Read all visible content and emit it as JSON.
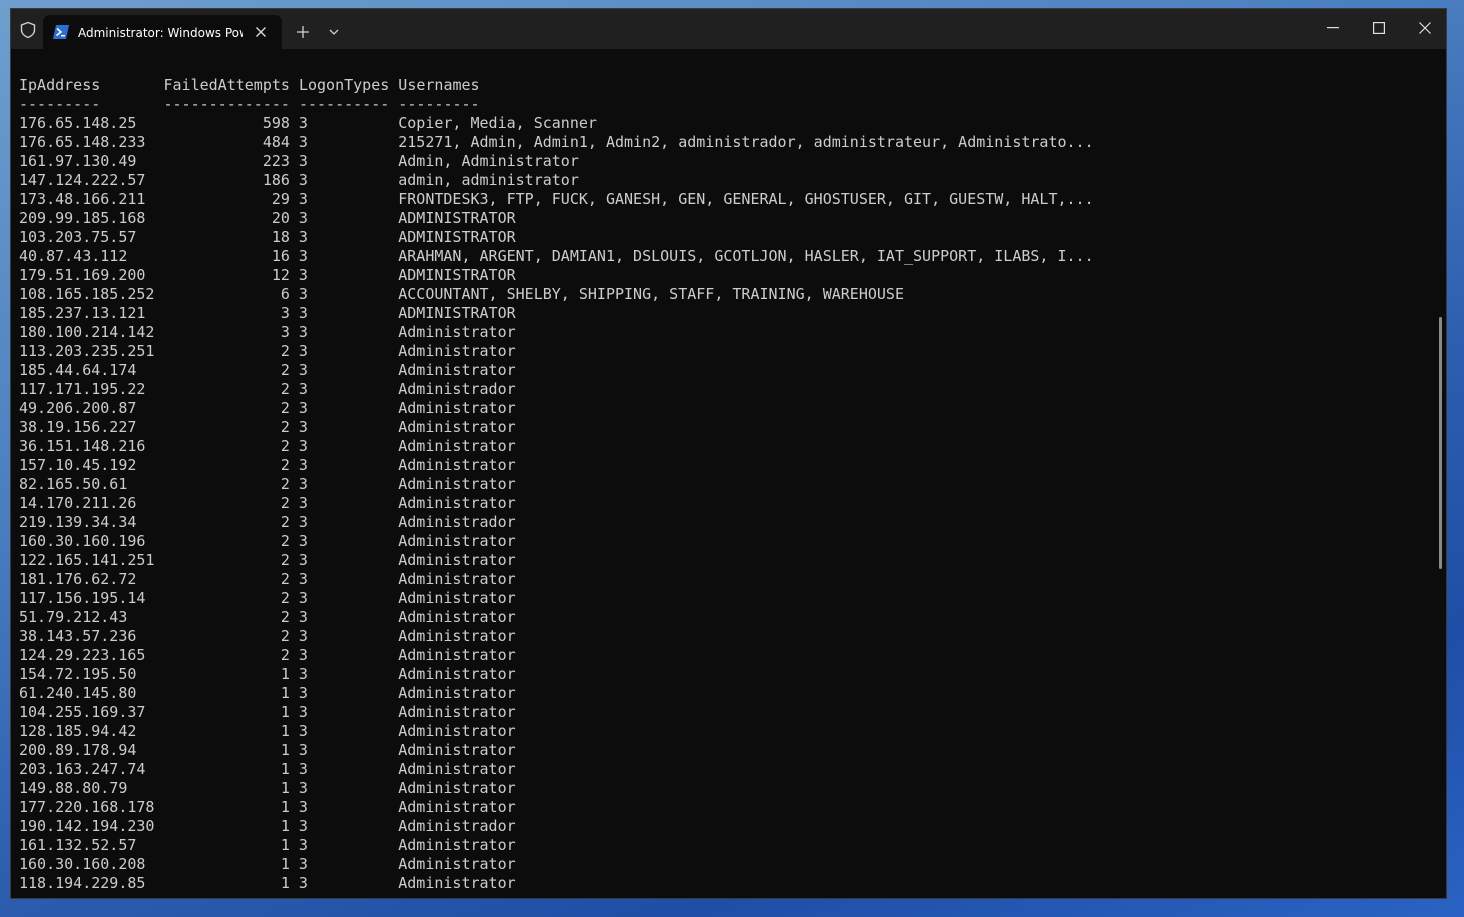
{
  "window": {
    "tab_title": "Administrator: Windows PowerShell"
  },
  "terminal": {
    "header": "IpAddress       FailedAttempts LogonTypes Usernames",
    "separator": "---------       -------------- ---------- ---------",
    "rows": [
      {
        "ip": "176.65.148.25",
        "attempts": "598",
        "logon": "3",
        "users": "Copier, Media, Scanner"
      },
      {
        "ip": "176.65.148.233",
        "attempts": "484",
        "logon": "3",
        "users": "215271, Admin, Admin1, Admin2, administrador, administrateur, Administrato..."
      },
      {
        "ip": "161.97.130.49",
        "attempts": "223",
        "logon": "3",
        "users": "Admin, Administrator"
      },
      {
        "ip": "147.124.222.57",
        "attempts": "186",
        "logon": "3",
        "users": "admin, administrator"
      },
      {
        "ip": "173.48.166.211",
        "attempts": "29",
        "logon": "3",
        "users": "FRONTDESK3, FTP, FUCK, GANESH, GEN, GENERAL, GHOSTUSER, GIT, GUESTW, HALT,..."
      },
      {
        "ip": "209.99.185.168",
        "attempts": "20",
        "logon": "3",
        "users": "ADMINISTRATOR"
      },
      {
        "ip": "103.203.75.57",
        "attempts": "18",
        "logon": "3",
        "users": "ADMINISTRATOR"
      },
      {
        "ip": "40.87.43.112",
        "attempts": "16",
        "logon": "3",
        "users": "ARAHMAN, ARGENT, DAMIAN1, DSLOUIS, GCOTLJON, HASLER, IAT_SUPPORT, ILABS, I..."
      },
      {
        "ip": "179.51.169.200",
        "attempts": "12",
        "logon": "3",
        "users": "ADMINISTRATOR"
      },
      {
        "ip": "108.165.185.252",
        "attempts": "6",
        "logon": "3",
        "users": "ACCOUNTANT, SHELBY, SHIPPING, STAFF, TRAINING, WAREHOUSE"
      },
      {
        "ip": "185.237.13.121",
        "attempts": "3",
        "logon": "3",
        "users": "ADMINISTRATOR"
      },
      {
        "ip": "180.100.214.142",
        "attempts": "3",
        "logon": "3",
        "users": "Administrator"
      },
      {
        "ip": "113.203.235.251",
        "attempts": "2",
        "logon": "3",
        "users": "Administrator"
      },
      {
        "ip": "185.44.64.174",
        "attempts": "2",
        "logon": "3",
        "users": "Administrator"
      },
      {
        "ip": "117.171.195.22",
        "attempts": "2",
        "logon": "3",
        "users": "Administrador"
      },
      {
        "ip": "49.206.200.87",
        "attempts": "2",
        "logon": "3",
        "users": "Administrator"
      },
      {
        "ip": "38.19.156.227",
        "attempts": "2",
        "logon": "3",
        "users": "Administrator"
      },
      {
        "ip": "36.151.148.216",
        "attempts": "2",
        "logon": "3",
        "users": "Administrator"
      },
      {
        "ip": "157.10.45.192",
        "attempts": "2",
        "logon": "3",
        "users": "Administrator"
      },
      {
        "ip": "82.165.50.61",
        "attempts": "2",
        "logon": "3",
        "users": "Administrator"
      },
      {
        "ip": "14.170.211.26",
        "attempts": "2",
        "logon": "3",
        "users": "Administrator"
      },
      {
        "ip": "219.139.34.34",
        "attempts": "2",
        "logon": "3",
        "users": "Administrador"
      },
      {
        "ip": "160.30.160.196",
        "attempts": "2",
        "logon": "3",
        "users": "Administrator"
      },
      {
        "ip": "122.165.141.251",
        "attempts": "2",
        "logon": "3",
        "users": "Administrator"
      },
      {
        "ip": "181.176.62.72",
        "attempts": "2",
        "logon": "3",
        "users": "Administrator"
      },
      {
        "ip": "117.156.195.14",
        "attempts": "2",
        "logon": "3",
        "users": "Administrator"
      },
      {
        "ip": "51.79.212.43",
        "attempts": "2",
        "logon": "3",
        "users": "Administrator"
      },
      {
        "ip": "38.143.57.236",
        "attempts": "2",
        "logon": "3",
        "users": "Administrator"
      },
      {
        "ip": "124.29.223.165",
        "attempts": "2",
        "logon": "3",
        "users": "Administrator"
      },
      {
        "ip": "154.72.195.50",
        "attempts": "1",
        "logon": "3",
        "users": "Administrator"
      },
      {
        "ip": "61.240.145.80",
        "attempts": "1",
        "logon": "3",
        "users": "Administrator"
      },
      {
        "ip": "104.255.169.37",
        "attempts": "1",
        "logon": "3",
        "users": "Administrator"
      },
      {
        "ip": "128.185.94.42",
        "attempts": "1",
        "logon": "3",
        "users": "Administrator"
      },
      {
        "ip": "200.89.178.94",
        "attempts": "1",
        "logon": "3",
        "users": "Administrator"
      },
      {
        "ip": "203.163.247.74",
        "attempts": "1",
        "logon": "3",
        "users": "Administrator"
      },
      {
        "ip": "149.88.80.79",
        "attempts": "1",
        "logon": "3",
        "users": "Administrator"
      },
      {
        "ip": "177.220.168.178",
        "attempts": "1",
        "logon": "3",
        "users": "Administrator"
      },
      {
        "ip": "190.142.194.230",
        "attempts": "1",
        "logon": "3",
        "users": "Administrador"
      },
      {
        "ip": "161.132.52.57",
        "attempts": "1",
        "logon": "3",
        "users": "Administrator"
      },
      {
        "ip": "160.30.160.208",
        "attempts": "1",
        "logon": "3",
        "users": "Administrator"
      },
      {
        "ip": "118.194.229.85",
        "attempts": "1",
        "logon": "3",
        "users": "Administrator"
      }
    ]
  }
}
